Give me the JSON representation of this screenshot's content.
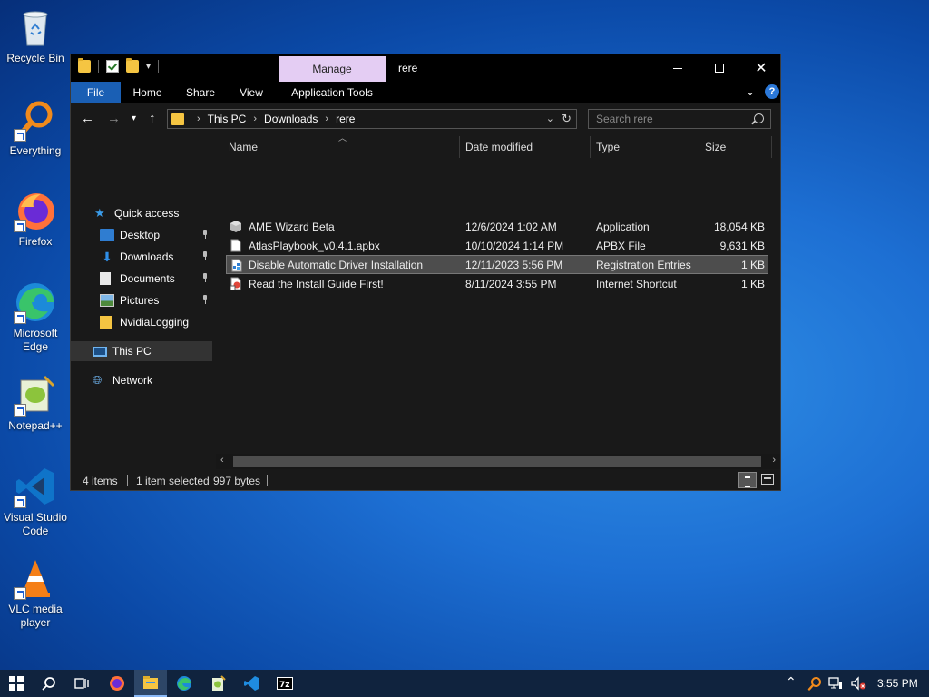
{
  "desktop": {
    "icons": [
      {
        "label": "Recycle Bin",
        "icon": "recycle-bin-icon"
      },
      {
        "label": "Everything",
        "icon": "everything-search-icon"
      },
      {
        "label": "Firefox",
        "icon": "firefox-icon"
      },
      {
        "label": "Microsoft Edge",
        "icon": "edge-icon"
      },
      {
        "label": "Notepad++",
        "icon": "notepad-plus-plus-icon"
      },
      {
        "label": "Visual Studio Code",
        "icon": "vscode-icon"
      },
      {
        "label": "VLC media player",
        "icon": "vlc-icon"
      }
    ]
  },
  "window": {
    "title": "rere",
    "manage_tab": "Manage",
    "ribbon": {
      "file": "File",
      "home": "Home",
      "share": "Share",
      "view": "View",
      "app_tools": "Application Tools"
    },
    "breadcrumb": [
      "This PC",
      "Downloads",
      "rere"
    ],
    "search_placeholder": "Search rere",
    "nav": {
      "quick_access": "Quick access",
      "items": [
        {
          "label": "Desktop",
          "pinned": true,
          "icon": "desktop-folder-icon"
        },
        {
          "label": "Downloads",
          "pinned": true,
          "icon": "downloads-folder-icon"
        },
        {
          "label": "Documents",
          "pinned": true,
          "icon": "documents-folder-icon"
        },
        {
          "label": "Pictures",
          "pinned": true,
          "icon": "pictures-folder-icon"
        },
        {
          "label": "NvidiaLogging",
          "pinned": false,
          "icon": "folder-icon"
        }
      ],
      "this_pc": "This PC",
      "network": "Network"
    },
    "columns": {
      "name": "Name",
      "date": "Date modified",
      "type": "Type",
      "size": "Size"
    },
    "files": [
      {
        "name": "AME Wizard Beta",
        "date": "12/6/2024 1:02 AM",
        "type": "Application",
        "size": "18,054 KB",
        "icon": "application-icon",
        "selected": false
      },
      {
        "name": "AtlasPlaybook_v0.4.1.apbx",
        "date": "10/10/2024 1:14 PM",
        "type": "APBX File",
        "size": "9,631 KB",
        "icon": "file-icon",
        "selected": false
      },
      {
        "name": "Disable Automatic Driver Installation",
        "date": "12/11/2023 5:56 PM",
        "type": "Registration Entries",
        "size": "1 KB",
        "icon": "registry-file-icon",
        "selected": true
      },
      {
        "name": "Read the Install Guide First!",
        "date": "8/11/2024 3:55 PM",
        "type": "Internet Shortcut",
        "size": "1 KB",
        "icon": "internet-shortcut-icon",
        "selected": false
      }
    ],
    "status": {
      "count": "4 items",
      "selected": "1 item selected",
      "bytes": "997 bytes"
    }
  },
  "taskbar": {
    "clock": "3:55 PM",
    "apps": [
      "start-icon",
      "search-icon",
      "task-view-icon",
      "firefox-icon",
      "file-explorer-icon",
      "edge-icon",
      "notepad-plus-plus-icon",
      "vscode-icon",
      "7zip-icon"
    ]
  }
}
